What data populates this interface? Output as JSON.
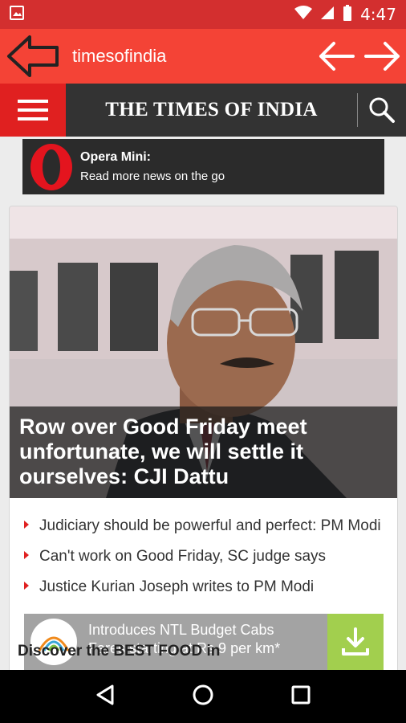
{
  "status_bar": {
    "time": "4:47"
  },
  "app_bar": {
    "title": "timesofindia"
  },
  "site_header": {
    "logo_text": "THE TIMES OF INDIA"
  },
  "opera_banner": {
    "title": "Opera Mini:",
    "subtitle": "Read more news on the go"
  },
  "hero": {
    "headline": "Row over Good Friday meet unfortunate, we will settle it ourselves: CJI Dattu"
  },
  "headlines": [
    "Judiciary should be powerful and perfect: PM Modi",
    "Can't work on Good Friday, SC judge says",
    "Justice Kurian Joseph writes to PM Modi"
  ],
  "ad": {
    "line1": "Introduces NTL Budget Cabs",
    "line2": "Fares starting at Rs 9 per km*"
  },
  "overlay_text": "Discover the BEST FOOD in",
  "colors": {
    "status_bar": "#d32f2f",
    "app_bar": "#f44336",
    "toi_red": "#e02020",
    "ad_green": "#a2cf4e"
  }
}
